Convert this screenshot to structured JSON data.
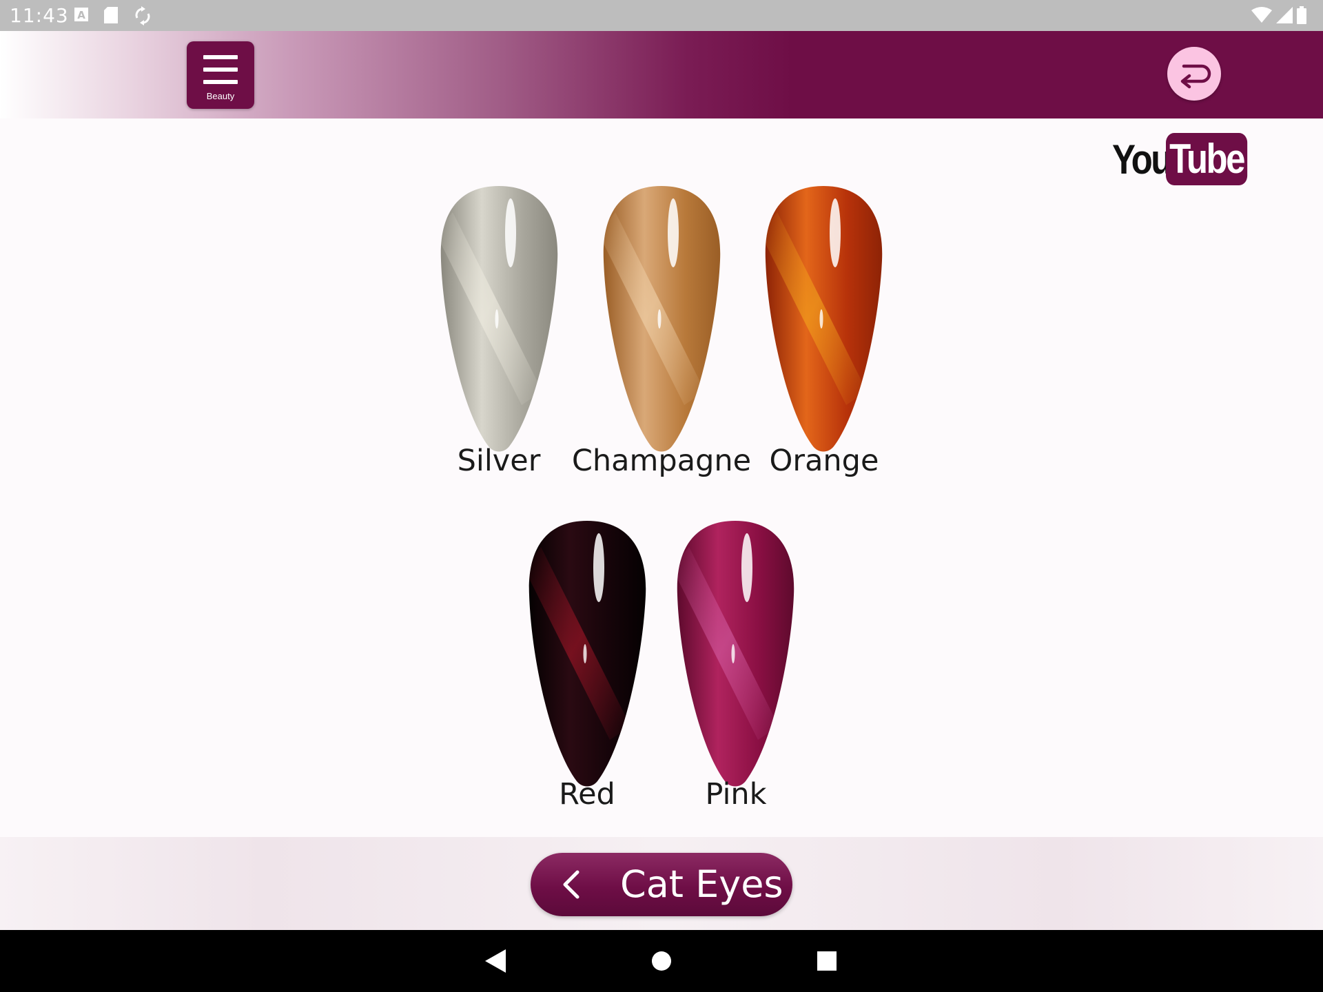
{
  "status_bar": {
    "time": "11:43",
    "left_icons": [
      "text-box-icon",
      "sd-card-icon",
      "sync-icon"
    ],
    "right_icons": [
      "wifi-icon",
      "signal-icon",
      "battery-icon"
    ]
  },
  "header": {
    "menu_label": "Beauty",
    "brand_color": "#6e0e46",
    "return_button_color": "#fbc4e2"
  },
  "youtube": {
    "you": "You",
    "tube": "Tube"
  },
  "swatches": [
    {
      "label": "Silver",
      "base": "#a9a79d",
      "light": "#d8d6cc",
      "dark": "#8a887e",
      "streak": "#efece0"
    },
    {
      "label": "Champagne",
      "base": "#b8793a",
      "light": "#d9a877",
      "dark": "#9a5e26",
      "streak": "#f1d2aa"
    },
    {
      "label": "Orange",
      "base": "#b7320a",
      "light": "#e3661a",
      "dark": "#8e2306",
      "streak": "#f2a31c"
    },
    {
      "label": "Red",
      "base": "#150409",
      "light": "#2a0a12",
      "dark": "#050102",
      "streak": "#a11526"
    },
    {
      "label": "Pink",
      "base": "#8a0f43",
      "light": "#b0235e",
      "dark": "#5e0a2d",
      "streak": "#d25aa0"
    }
  ],
  "category": {
    "label": "Cat Eyes"
  }
}
